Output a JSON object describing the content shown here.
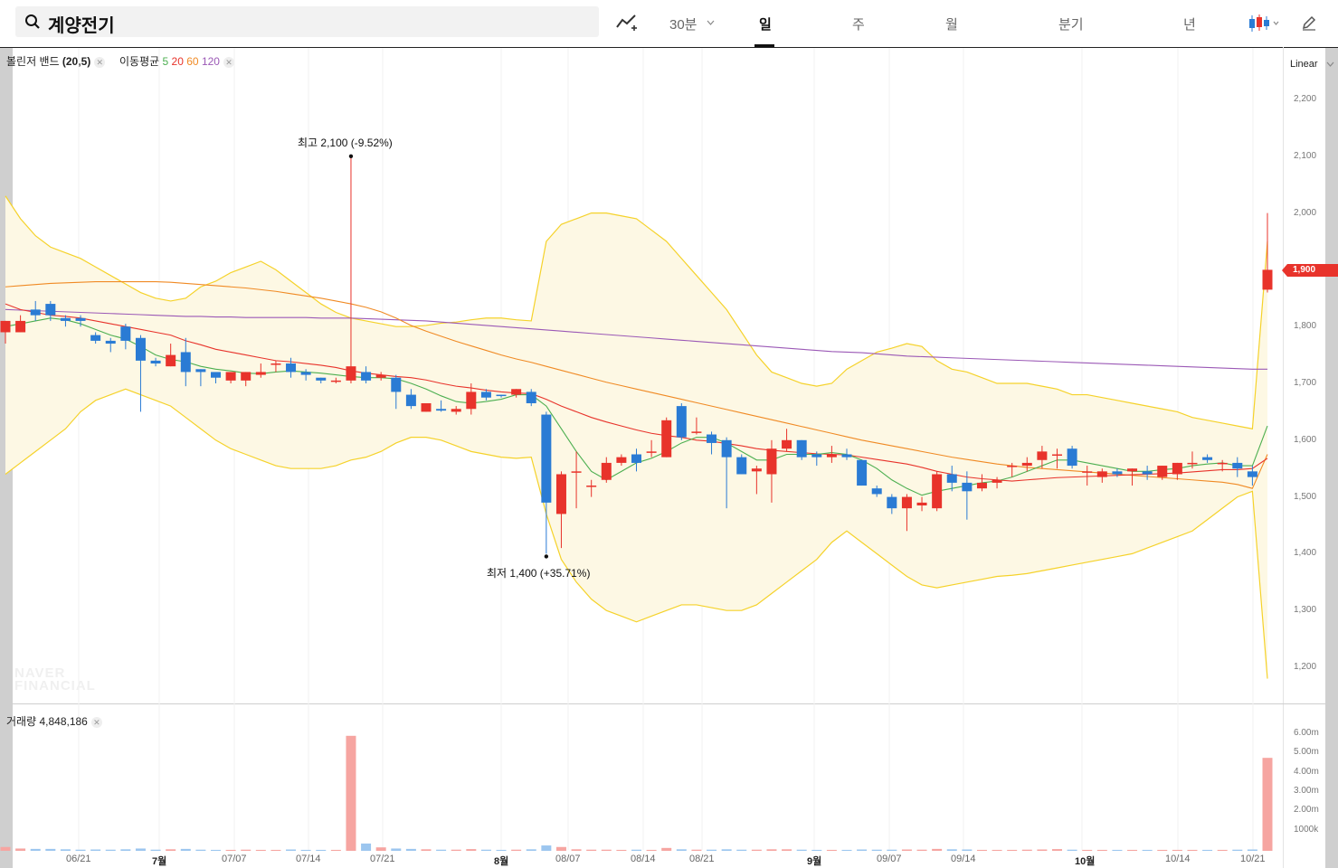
{
  "header": {
    "stock_name": "계양전기",
    "interval": "30분",
    "tabs": [
      "일",
      "주",
      "월",
      "분기",
      "년"
    ],
    "active_tab": "일"
  },
  "indicators": {
    "bollinger_label": "볼린저 밴드",
    "bollinger_params": "(20,5)",
    "ma_label": "이동평균",
    "ma_periods": [
      "5",
      "20",
      "60",
      "120"
    ],
    "ma_colors": [
      "#4caf50",
      "#e8332b",
      "#f08a24",
      "#9b59b6"
    ]
  },
  "scale_mode": "Linear",
  "price_axis": [
    "2,200",
    "2,100",
    "2,000",
    "1,900",
    "1,800",
    "1,700",
    "1,600",
    "1,500",
    "1,400",
    "1,300",
    "1,200"
  ],
  "current_price": "1,900",
  "annotations": {
    "high": "최고 2,100 (-9.52%)",
    "low": "최저 1,400 (+35.71%)"
  },
  "watermark": [
    "NAVER",
    "FINANCIAL"
  ],
  "volume": {
    "label": "거래량",
    "value": "4,848,186",
    "axis": [
      "6.00m",
      "5.00m",
      "4.00m",
      "3.00m",
      "2.00m",
      "1000k"
    ]
  },
  "x_axis": [
    {
      "label": "06/21",
      "bold": false
    },
    {
      "label": "7월",
      "bold": true
    },
    {
      "label": "07/07",
      "bold": false
    },
    {
      "label": "07/14",
      "bold": false
    },
    {
      "label": "07/21",
      "bold": false
    },
    {
      "label": "8월",
      "bold": true
    },
    {
      "label": "08/07",
      "bold": false
    },
    {
      "label": "08/14",
      "bold": false
    },
    {
      "label": "08/21",
      "bold": false
    },
    {
      "label": "9월",
      "bold": true
    },
    {
      "label": "09/07",
      "bold": false
    },
    {
      "label": "09/14",
      "bold": false
    },
    {
      "label": "10월",
      "bold": true
    },
    {
      "label": "10/14",
      "bold": false
    },
    {
      "label": "10/21",
      "bold": false
    }
  ],
  "colors": {
    "up": "#e8332b",
    "down": "#2a7bd4",
    "band": "#f5d22a",
    "band_fill": "#fdf8e4"
  },
  "chart_data": {
    "type": "candlestick",
    "candles": [
      {
        "o": 1790,
        "h": 1810,
        "l": 1770,
        "c": 1810,
        "v": 0.2
      },
      {
        "o": 1790,
        "h": 1820,
        "l": 1790,
        "c": 1810,
        "v": 0.12
      },
      {
        "o": 1830,
        "h": 1845,
        "l": 1810,
        "c": 1820,
        "v": 0.1
      },
      {
        "o": 1840,
        "h": 1845,
        "l": 1810,
        "c": 1820,
        "v": 0.1
      },
      {
        "o": 1815,
        "h": 1820,
        "l": 1800,
        "c": 1810,
        "v": 0.08
      },
      {
        "o": 1815,
        "h": 1820,
        "l": 1800,
        "c": 1810,
        "v": 0.06
      },
      {
        "o": 1785,
        "h": 1790,
        "l": 1770,
        "c": 1775,
        "v": 0.07
      },
      {
        "o": 1775,
        "h": 1780,
        "l": 1755,
        "c": 1770,
        "v": 0.06
      },
      {
        "o": 1800,
        "h": 1805,
        "l": 1760,
        "c": 1775,
        "v": 0.08
      },
      {
        "o": 1780,
        "h": 1785,
        "l": 1650,
        "c": 1740,
        "v": 0.12
      },
      {
        "o": 1740,
        "h": 1745,
        "l": 1730,
        "c": 1735,
        "v": 0.06
      },
      {
        "o": 1730,
        "h": 1770,
        "l": 1730,
        "c": 1750,
        "v": 0.08
      },
      {
        "o": 1755,
        "h": 1780,
        "l": 1695,
        "c": 1720,
        "v": 0.1
      },
      {
        "o": 1725,
        "h": 1725,
        "l": 1695,
        "c": 1720,
        "v": 0.06
      },
      {
        "o": 1720,
        "h": 1720,
        "l": 1700,
        "c": 1710,
        "v": 0.05
      },
      {
        "o": 1705,
        "h": 1720,
        "l": 1700,
        "c": 1720,
        "v": 0.05
      },
      {
        "o": 1705,
        "h": 1720,
        "l": 1695,
        "c": 1720,
        "v": 0.06
      },
      {
        "o": 1715,
        "h": 1735,
        "l": 1710,
        "c": 1720,
        "v": 0.05
      },
      {
        "o": 1735,
        "h": 1740,
        "l": 1720,
        "c": 1735,
        "v": 0.05
      },
      {
        "o": 1735,
        "h": 1745,
        "l": 1710,
        "c": 1720,
        "v": 0.07
      },
      {
        "o": 1720,
        "h": 1725,
        "l": 1705,
        "c": 1715,
        "v": 0.05
      },
      {
        "o": 1710,
        "h": 1710,
        "l": 1700,
        "c": 1705,
        "v": 0.05
      },
      {
        "o": 1705,
        "h": 1710,
        "l": 1700,
        "c": 1705,
        "v": 0.05
      },
      {
        "o": 1705,
        "h": 2100,
        "l": 1700,
        "c": 1730,
        "v": 6.0
      },
      {
        "o": 1720,
        "h": 1730,
        "l": 1700,
        "c": 1705,
        "v": 0.38
      },
      {
        "o": 1710,
        "h": 1720,
        "l": 1705,
        "c": 1715,
        "v": 0.18
      },
      {
        "o": 1710,
        "h": 1715,
        "l": 1655,
        "c": 1685,
        "v": 0.12
      },
      {
        "o": 1680,
        "h": 1690,
        "l": 1655,
        "c": 1660,
        "v": 0.1
      },
      {
        "o": 1650,
        "h": 1665,
        "l": 1650,
        "c": 1665,
        "v": 0.08
      },
      {
        "o": 1655,
        "h": 1670,
        "l": 1650,
        "c": 1652,
        "v": 0.06
      },
      {
        "o": 1650,
        "h": 1660,
        "l": 1645,
        "c": 1655,
        "v": 0.06
      },
      {
        "o": 1655,
        "h": 1700,
        "l": 1645,
        "c": 1685,
        "v": 0.09
      },
      {
        "o": 1685,
        "h": 1690,
        "l": 1670,
        "c": 1675,
        "v": 0.06
      },
      {
        "o": 1680,
        "h": 1680,
        "l": 1675,
        "c": 1678,
        "v": 0.05
      },
      {
        "o": 1680,
        "h": 1690,
        "l": 1675,
        "c": 1690,
        "v": 0.06
      },
      {
        "o": 1685,
        "h": 1690,
        "l": 1660,
        "c": 1665,
        "v": 0.08
      },
      {
        "o": 1645,
        "h": 1650,
        "l": 1400,
        "c": 1490,
        "v": 0.28
      },
      {
        "o": 1470,
        "h": 1545,
        "l": 1410,
        "c": 1540,
        "v": 0.2
      },
      {
        "o": 1545,
        "h": 1580,
        "l": 1480,
        "c": 1545,
        "v": 0.08
      },
      {
        "o": 1520,
        "h": 1530,
        "l": 1500,
        "c": 1520,
        "v": 0.06
      },
      {
        "o": 1530,
        "h": 1570,
        "l": 1525,
        "c": 1560,
        "v": 0.06
      },
      {
        "o": 1560,
        "h": 1575,
        "l": 1555,
        "c": 1570,
        "v": 0.05
      },
      {
        "o": 1575,
        "h": 1585,
        "l": 1545,
        "c": 1560,
        "v": 0.06
      },
      {
        "o": 1580,
        "h": 1600,
        "l": 1570,
        "c": 1580,
        "v": 0.05
      },
      {
        "o": 1570,
        "h": 1640,
        "l": 1570,
        "c": 1635,
        "v": 0.15
      },
      {
        "o": 1660,
        "h": 1665,
        "l": 1600,
        "c": 1605,
        "v": 0.08
      },
      {
        "o": 1615,
        "h": 1640,
        "l": 1610,
        "c": 1615,
        "v": 0.06
      },
      {
        "o": 1610,
        "h": 1615,
        "l": 1575,
        "c": 1595,
        "v": 0.06
      },
      {
        "o": 1600,
        "h": 1605,
        "l": 1480,
        "c": 1570,
        "v": 0.08
      },
      {
        "o": 1570,
        "h": 1575,
        "l": 1540,
        "c": 1540,
        "v": 0.06
      },
      {
        "o": 1545,
        "h": 1555,
        "l": 1505,
        "c": 1550,
        "v": 0.06
      },
      {
        "o": 1540,
        "h": 1600,
        "l": 1490,
        "c": 1585,
        "v": 0.08
      },
      {
        "o": 1585,
        "h": 1620,
        "l": 1580,
        "c": 1600,
        "v": 0.08
      },
      {
        "o": 1600,
        "h": 1600,
        "l": 1565,
        "c": 1570,
        "v": 0.06
      },
      {
        "o": 1575,
        "h": 1580,
        "l": 1555,
        "c": 1570,
        "v": 0.05
      },
      {
        "o": 1570,
        "h": 1590,
        "l": 1560,
        "c": 1575,
        "v": 0.05
      },
      {
        "o": 1575,
        "h": 1585,
        "l": 1565,
        "c": 1570,
        "v": 0.05
      },
      {
        "o": 1565,
        "h": 1565,
        "l": 1520,
        "c": 1520,
        "v": 0.07
      },
      {
        "o": 1515,
        "h": 1520,
        "l": 1500,
        "c": 1505,
        "v": 0.06
      },
      {
        "o": 1500,
        "h": 1505,
        "l": 1470,
        "c": 1480,
        "v": 0.06
      },
      {
        "o": 1480,
        "h": 1505,
        "l": 1440,
        "c": 1500,
        "v": 0.07
      },
      {
        "o": 1485,
        "h": 1500,
        "l": 1475,
        "c": 1490,
        "v": 0.06
      },
      {
        "o": 1480,
        "h": 1545,
        "l": 1475,
        "c": 1540,
        "v": 0.1
      },
      {
        "o": 1540,
        "h": 1555,
        "l": 1510,
        "c": 1525,
        "v": 0.08
      },
      {
        "o": 1525,
        "h": 1545,
        "l": 1460,
        "c": 1510,
        "v": 0.07
      },
      {
        "o": 1515,
        "h": 1540,
        "l": 1510,
        "c": 1525,
        "v": 0.05
      },
      {
        "o": 1525,
        "h": 1535,
        "l": 1515,
        "c": 1530,
        "v": 0.05
      },
      {
        "o": 1555,
        "h": 1560,
        "l": 1535,
        "c": 1555,
        "v": 0.05
      },
      {
        "o": 1555,
        "h": 1570,
        "l": 1545,
        "c": 1560,
        "v": 0.06
      },
      {
        "o": 1565,
        "h": 1590,
        "l": 1550,
        "c": 1580,
        "v": 0.07
      },
      {
        "o": 1575,
        "h": 1585,
        "l": 1550,
        "c": 1575,
        "v": 0.09
      },
      {
        "o": 1585,
        "h": 1590,
        "l": 1550,
        "c": 1555,
        "v": 0.06
      },
      {
        "o": 1545,
        "h": 1555,
        "l": 1520,
        "c": 1545,
        "v": 0.05
      },
      {
        "o": 1535,
        "h": 1550,
        "l": 1525,
        "c": 1545,
        "v": 0.05
      },
      {
        "o": 1545,
        "h": 1550,
        "l": 1535,
        "c": 1540,
        "v": 0.05
      },
      {
        "o": 1545,
        "h": 1550,
        "l": 1520,
        "c": 1550,
        "v": 0.05
      },
      {
        "o": 1545,
        "h": 1555,
        "l": 1530,
        "c": 1540,
        "v": 0.05
      },
      {
        "o": 1535,
        "h": 1555,
        "l": 1530,
        "c": 1555,
        "v": 0.05
      },
      {
        "o": 1540,
        "h": 1560,
        "l": 1530,
        "c": 1560,
        "v": 0.05
      },
      {
        "o": 1560,
        "h": 1580,
        "l": 1550,
        "c": 1560,
        "v": 0.05
      },
      {
        "o": 1570,
        "h": 1575,
        "l": 1560,
        "c": 1565,
        "v": 0.05
      },
      {
        "o": 1560,
        "h": 1565,
        "l": 1545,
        "c": 1560,
        "v": 0.05
      },
      {
        "o": 1560,
        "h": 1570,
        "l": 1535,
        "c": 1550,
        "v": 0.06
      },
      {
        "o": 1545,
        "h": 1555,
        "l": 1520,
        "c": 1535,
        "v": 0.07
      },
      {
        "o": 1865,
        "h": 2000,
        "l": 1860,
        "c": 1900,
        "v": 4.85
      }
    ],
    "ma5": [
      1800,
      1805,
      1810,
      1815,
      1812,
      1805,
      1795,
      1785,
      1778,
      1765,
      1750,
      1742,
      1738,
      1730,
      1725,
      1722,
      1718,
      1717,
      1720,
      1722,
      1720,
      1718,
      1715,
      1712,
      1710,
      1710,
      1708,
      1700,
      1690,
      1678,
      1668,
      1665,
      1668,
      1672,
      1680,
      1680,
      1660,
      1620,
      1580,
      1545,
      1530,
      1545,
      1560,
      1568,
      1580,
      1595,
      1605,
      1605,
      1595,
      1580,
      1565,
      1565,
      1575,
      1575,
      1575,
      1578,
      1575,
      1565,
      1550,
      1530,
      1515,
      1503,
      1510,
      1515,
      1520,
      1525,
      1528,
      1535,
      1545,
      1555,
      1565,
      1565,
      1560,
      1555,
      1550,
      1545,
      1545,
      1548,
      1550,
      1555,
      1558,
      1560,
      1555,
      1555,
      1625
    ],
    "ma20": [
      1840,
      1830,
      1825,
      1820,
      1818,
      1815,
      1810,
      1805,
      1800,
      1795,
      1790,
      1785,
      1775,
      1768,
      1760,
      1755,
      1750,
      1745,
      1740,
      1738,
      1735,
      1732,
      1728,
      1722,
      1718,
      1715,
      1712,
      1710,
      1706,
      1700,
      1695,
      1692,
      1688,
      1685,
      1683,
      1682,
      1672,
      1660,
      1650,
      1640,
      1632,
      1625,
      1618,
      1612,
      1608,
      1605,
      1600,
      1598,
      1594,
      1590,
      1585,
      1582,
      1580,
      1578,
      1576,
      1575,
      1574,
      1570,
      1566,
      1562,
      1558,
      1552,
      1545,
      1540,
      1535,
      1532,
      1530,
      1528,
      1530,
      1532,
      1534,
      1535,
      1536,
      1537,
      1538,
      1539,
      1540,
      1541,
      1542,
      1544,
      1546,
      1548,
      1548,
      1550,
      1568
    ],
    "ma60": [
      1870,
      1872,
      1874,
      1876,
      1877,
      1878,
      1879,
      1879,
      1879,
      1879,
      1879,
      1878,
      1876,
      1874,
      1872,
      1870,
      1868,
      1865,
      1862,
      1858,
      1854,
      1850,
      1845,
      1840,
      1834,
      1826,
      1815,
      1802,
      1792,
      1783,
      1774,
      1766,
      1758,
      1750,
      1743,
      1737,
      1730,
      1723,
      1716,
      1709,
      1702,
      1696,
      1690,
      1684,
      1678,
      1672,
      1666,
      1660,
      1654,
      1648,
      1642,
      1636,
      1630,
      1624,
      1618,
      1612,
      1606,
      1600,
      1595,
      1590,
      1585,
      1580,
      1575,
      1570,
      1566,
      1562,
      1558,
      1555,
      1552,
      1550,
      1548,
      1546,
      1544,
      1542,
      1540,
      1538,
      1536,
      1534,
      1532,
      1530,
      1528,
      1526,
      1522,
      1515,
      1575
    ],
    "ma120": [
      1830,
      1829,
      1828,
      1827,
      1826,
      1825,
      1824,
      1823,
      1822,
      1821,
      1820,
      1819,
      1818,
      1818,
      1817,
      1817,
      1816,
      1816,
      1816,
      1816,
      1816,
      1815,
      1815,
      1815,
      1814,
      1813,
      1812,
      1811,
      1810,
      1808,
      1806,
      1804,
      1802,
      1800,
      1798,
      1796,
      1794,
      1792,
      1790,
      1788,
      1786,
      1784,
      1782,
      1780,
      1778,
      1776,
      1774,
      1772,
      1770,
      1768,
      1766,
      1764,
      1762,
      1760,
      1758,
      1756,
      1755,
      1754,
      1752,
      1750,
      1748,
      1747,
      1746,
      1745,
      1744,
      1743,
      1742,
      1741,
      1740,
      1739,
      1738,
      1737,
      1736,
      1735,
      1734,
      1733,
      1732,
      1731,
      1730,
      1729,
      1728,
      1727,
      1726,
      1725,
      1725
    ],
    "bb_upper": [
      2030,
      1990,
      1960,
      1940,
      1930,
      1920,
      1905,
      1890,
      1875,
      1860,
      1850,
      1845,
      1850,
      1870,
      1880,
      1895,
      1905,
      1915,
      1900,
      1880,
      1860,
      1840,
      1825,
      1815,
      1810,
      1805,
      1800,
      1800,
      1802,
      1806,
      1808,
      1812,
      1815,
      1815,
      1812,
      1810,
      1950,
      1980,
      1990,
      2000,
      2000,
      1995,
      1990,
      1970,
      1950,
      1920,
      1890,
      1860,
      1830,
      1790,
      1750,
      1720,
      1710,
      1700,
      1695,
      1700,
      1725,
      1740,
      1755,
      1762,
      1770,
      1765,
      1740,
      1725,
      1720,
      1710,
      1700,
      1700,
      1700,
      1695,
      1690,
      1680,
      1680,
      1675,
      1670,
      1665,
      1660,
      1655,
      1650,
      1640,
      1635,
      1630,
      1625,
      1620,
      1950
    ],
    "bb_lower": [
      1540,
      1560,
      1580,
      1600,
      1620,
      1650,
      1670,
      1680,
      1690,
      1680,
      1670,
      1660,
      1640,
      1620,
      1600,
      1585,
      1575,
      1565,
      1555,
      1550,
      1550,
      1550,
      1555,
      1565,
      1570,
      1580,
      1595,
      1605,
      1605,
      1600,
      1590,
      1580,
      1575,
      1570,
      1568,
      1570,
      1470,
      1390,
      1350,
      1320,
      1300,
      1290,
      1280,
      1290,
      1300,
      1310,
      1310,
      1305,
      1300,
      1300,
      1310,
      1330,
      1350,
      1370,
      1390,
      1420,
      1440,
      1420,
      1400,
      1380,
      1360,
      1345,
      1340,
      1345,
      1350,
      1355,
      1360,
      1362,
      1365,
      1370,
      1375,
      1380,
      1385,
      1390,
      1395,
      1400,
      1410,
      1420,
      1430,
      1440,
      1460,
      1480,
      1500,
      1510,
      1180
    ],
    "last": {
      "price": 1900,
      "volume": 4848186
    }
  }
}
